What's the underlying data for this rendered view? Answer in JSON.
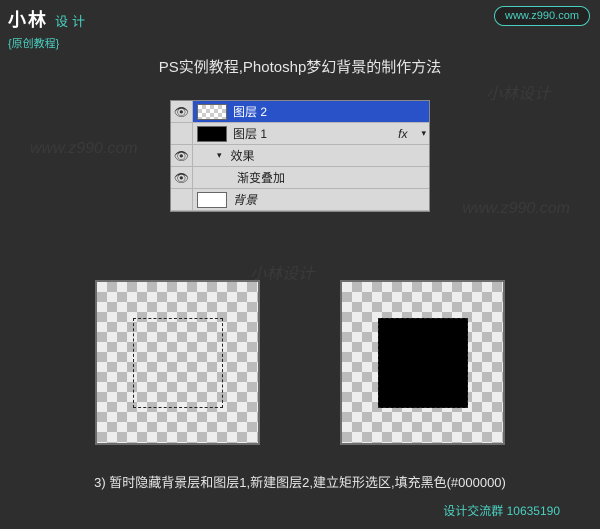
{
  "logo": {
    "brand_cn": "小林",
    "brand_suffix": "设计",
    "sub": "{原创教程}"
  },
  "site_url": "www.z990.com",
  "title": "PS实例教程,Photoshp梦幻背景的制作方法",
  "watermarks": [
    "小林设计",
    "www.z990.com",
    "小林设计",
    "www.z990.com"
  ],
  "layers": {
    "row0": {
      "name": "图层 2"
    },
    "row1": {
      "name": "图层 1",
      "fx": "fx"
    },
    "row2": {
      "name": "效果"
    },
    "row3": {
      "name": "渐变叠加"
    },
    "row4": {
      "name": "背景"
    }
  },
  "caption": "3) 暂时隐藏背景层和图层1,新建图层2,建立矩形选区,填充黑色(#000000)",
  "footer": "设计交流群 10635190"
}
